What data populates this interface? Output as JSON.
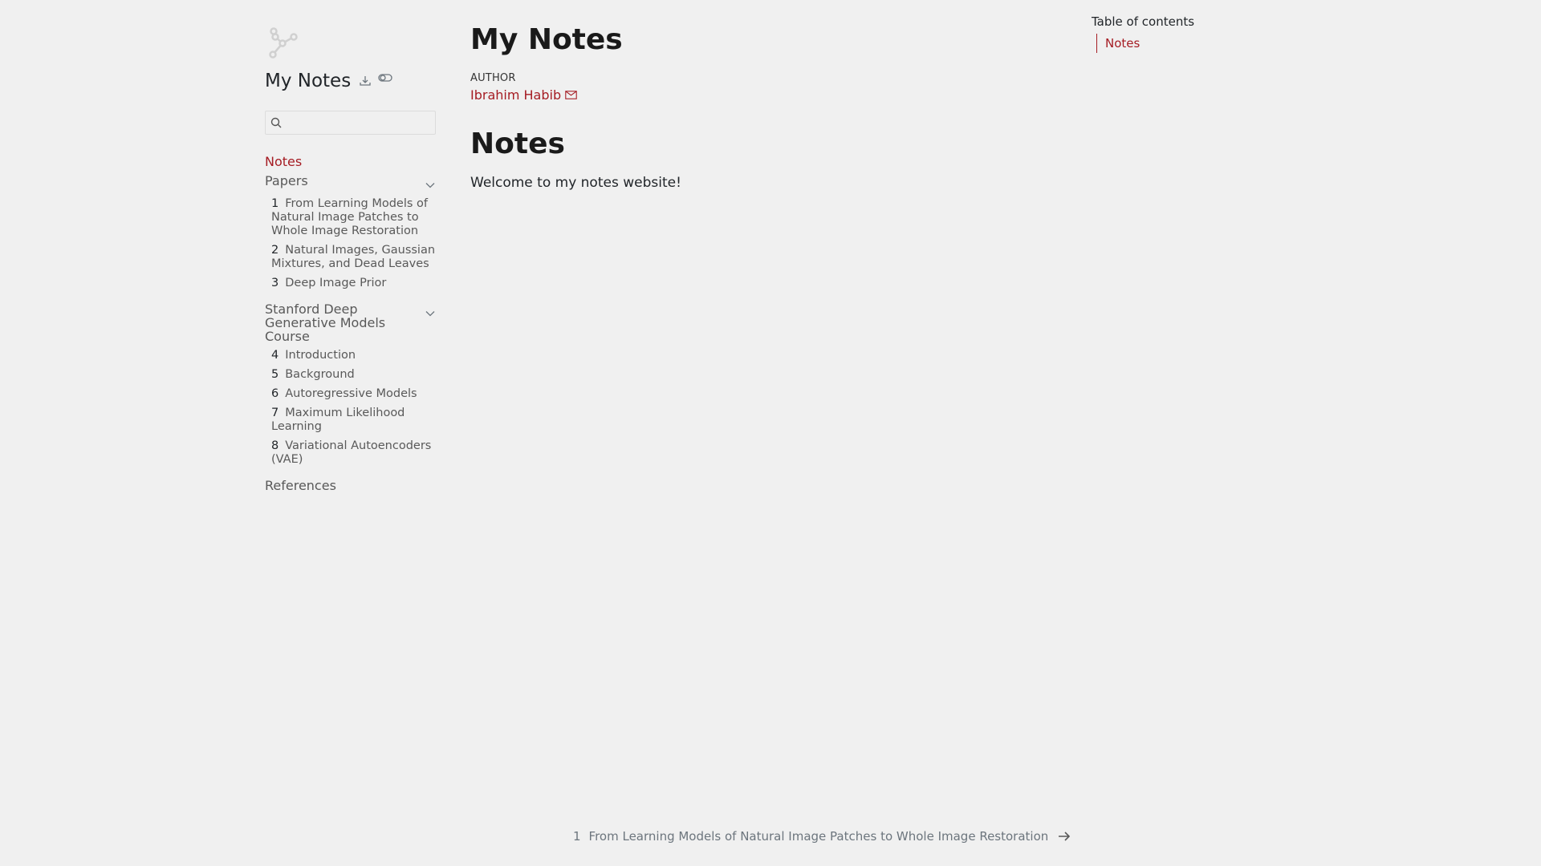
{
  "sidebar": {
    "title": "My Notes",
    "search": {
      "placeholder": "",
      "value": ""
    },
    "nav_home": "Notes",
    "sections": [
      {
        "label": "Papers",
        "items": [
          {
            "num": "1",
            "label": "From Learning Models of Natural Image Patches to Whole Image Restoration"
          },
          {
            "num": "2",
            "label": "Natural Images, Gaussian Mixtures, and Dead Leaves"
          },
          {
            "num": "3",
            "label": "Deep Image Prior"
          }
        ]
      },
      {
        "label": "Stanford Deep Generative Models Course",
        "items": [
          {
            "num": "4",
            "label": "Introduction"
          },
          {
            "num": "5",
            "label": "Background"
          },
          {
            "num": "6",
            "label": "Autoregressive Models"
          },
          {
            "num": "7",
            "label": "Maximum Likelihood Learning"
          },
          {
            "num": "8",
            "label": "Variational Autoencoders (VAE)"
          }
        ]
      }
    ],
    "references": "References"
  },
  "main": {
    "title": "My Notes",
    "author_heading": "AUTHOR",
    "author_name": "Ibrahim Habib",
    "section_heading": "Notes",
    "body": "Welcome to my notes website!"
  },
  "toc": {
    "title": "Table of contents",
    "items": [
      "Notes"
    ]
  },
  "next": {
    "num": "1",
    "label": "From Learning Models of Natural Image Patches to Whole Image Restoration"
  },
  "colors": {
    "accent": "#a51c23",
    "background": "#f0f0f0",
    "muted": "#595959"
  }
}
